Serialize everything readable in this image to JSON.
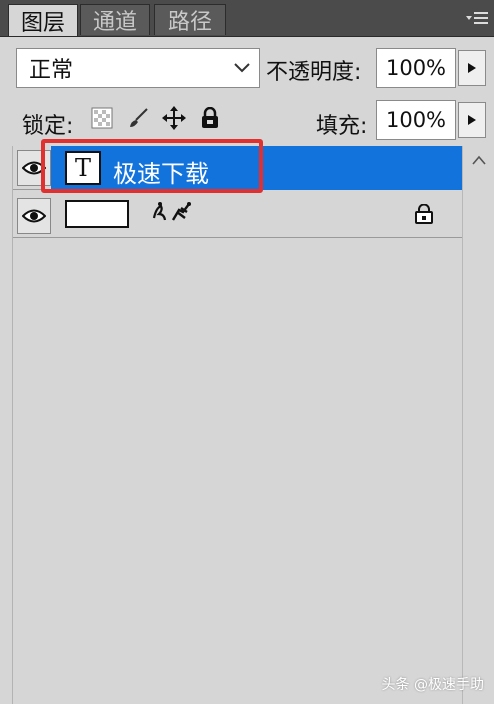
{
  "tabs": [
    {
      "label": "图层",
      "active": true
    },
    {
      "label": "通道",
      "active": false
    },
    {
      "label": "路径",
      "active": false
    }
  ],
  "panel_menu_icon": "panel-menu-icon",
  "blend": {
    "mode": "正常",
    "opacity_label": "不透明度:",
    "opacity": "100%"
  },
  "lock": {
    "label": "锁定:",
    "fill_label": "填充:",
    "fill": "100%",
    "icons": [
      "lock-transparent-icon",
      "lock-paint-icon",
      "lock-move-icon",
      "lock-all-icon"
    ]
  },
  "layers": [
    {
      "name": "极速下载",
      "kind": "text",
      "thumb_glyph": "T",
      "selected": true,
      "visible": true
    },
    {
      "name": "Background",
      "kind": "background",
      "selected": false,
      "visible": true,
      "locked": true
    }
  ],
  "colors": {
    "selection": "#1273dd",
    "highlight": "#e03030",
    "panel": "#d6d6d6",
    "tabbar": "#4b4b4b"
  },
  "watermark": "头条 @极速手助"
}
